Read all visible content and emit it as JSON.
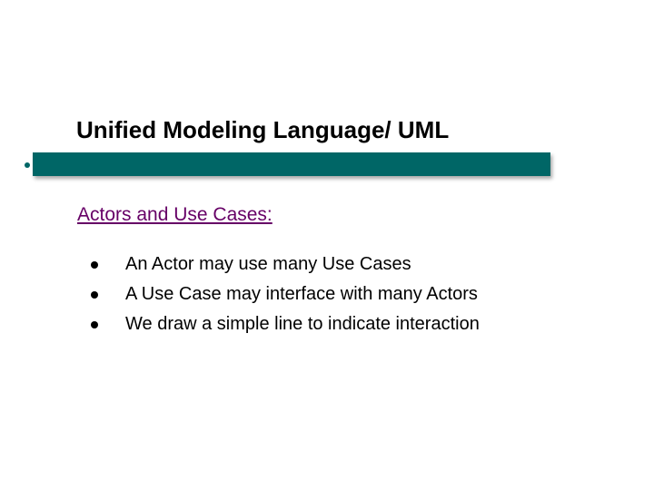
{
  "title": "Unified Modeling Language/ UML",
  "subheading": "Actors and Use Cases:",
  "bullets": [
    "An Actor may use many Use Cases",
    "A Use Case may interface with many Actors",
    "We draw a simple line to indicate interaction"
  ],
  "colors": {
    "bar": "#006666",
    "subheading": "#660066"
  }
}
